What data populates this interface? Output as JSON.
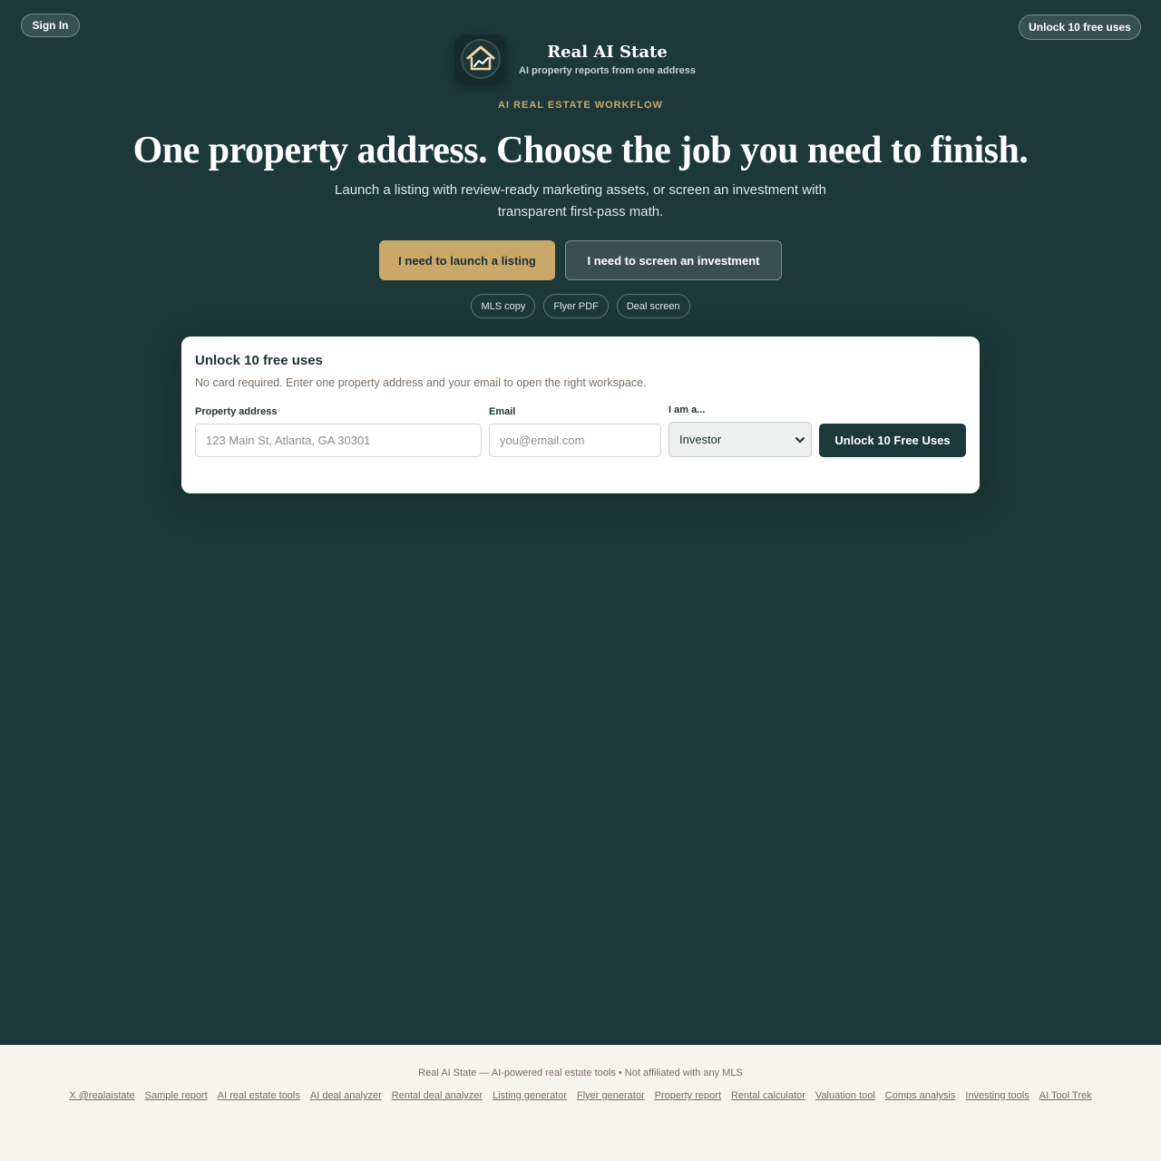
{
  "header": {
    "sign_in_label": "Sign In",
    "unlock_label": "Unlock 10 free uses"
  },
  "brand": {
    "name": "Real AI State",
    "tagline": "AI property reports from one address",
    "logo_icon": "house-chart-icon"
  },
  "hero": {
    "eyebrow": "AI REAL ESTATE WORKFLOW",
    "headline": "One property address. Choose the job you need to finish.",
    "subhead": "Launch a listing with review-ready marketing assets, or screen an investment with transparent first-pass math.",
    "cta_listing": "I need to launch a listing",
    "cta_invest": "I need to screen an investment",
    "chips": [
      "MLS copy",
      "Flyer PDF",
      "Deal screen"
    ]
  },
  "form": {
    "title": "Unlock 10 free uses",
    "description": "No card required. Enter one property address and your email to open the right workspace.",
    "address_label": "Property address",
    "address_placeholder": "123 Main St, Atlanta, GA 30301",
    "email_label": "Email",
    "email_placeholder": "you@email.com",
    "role_label": "I am a...",
    "role_value": "Investor",
    "submit_label": "Unlock 10 Free Uses"
  },
  "footer": {
    "note": "Real AI State — AI-powered real estate tools • Not affiliated with any MLS",
    "links": [
      "X @realaistate",
      "Sample report",
      "AI real estate tools",
      "AI deal analyzer",
      "Rental deal analyzer",
      "Listing generator",
      "Flyer generator",
      "Property report",
      "Rental calculator",
      "Valuation tool",
      "Comps analysis",
      "Investing tools",
      "AI Tool Trek"
    ]
  },
  "colors": {
    "background": "#1c3838",
    "accent_gold": "#c9a86a",
    "footer_bg": "#f6f4ef"
  }
}
